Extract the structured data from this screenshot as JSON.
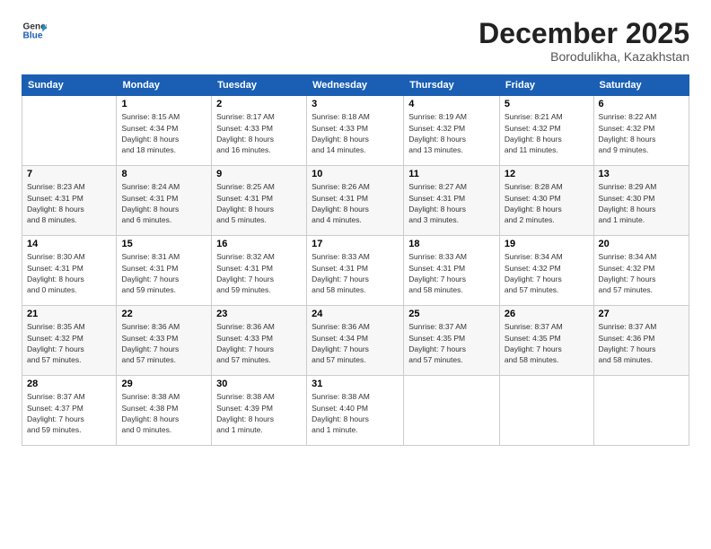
{
  "header": {
    "logo_line1": "General",
    "logo_line2": "Blue",
    "month": "December 2025",
    "location": "Borodulikha, Kazakhstan"
  },
  "days_of_week": [
    "Sunday",
    "Monday",
    "Tuesday",
    "Wednesday",
    "Thursday",
    "Friday",
    "Saturday"
  ],
  "weeks": [
    [
      {
        "day": "",
        "info": ""
      },
      {
        "day": "1",
        "info": "Sunrise: 8:15 AM\nSunset: 4:34 PM\nDaylight: 8 hours\nand 18 minutes."
      },
      {
        "day": "2",
        "info": "Sunrise: 8:17 AM\nSunset: 4:33 PM\nDaylight: 8 hours\nand 16 minutes."
      },
      {
        "day": "3",
        "info": "Sunrise: 8:18 AM\nSunset: 4:33 PM\nDaylight: 8 hours\nand 14 minutes."
      },
      {
        "day": "4",
        "info": "Sunrise: 8:19 AM\nSunset: 4:32 PM\nDaylight: 8 hours\nand 13 minutes."
      },
      {
        "day": "5",
        "info": "Sunrise: 8:21 AM\nSunset: 4:32 PM\nDaylight: 8 hours\nand 11 minutes."
      },
      {
        "day": "6",
        "info": "Sunrise: 8:22 AM\nSunset: 4:32 PM\nDaylight: 8 hours\nand 9 minutes."
      }
    ],
    [
      {
        "day": "7",
        "info": "Sunrise: 8:23 AM\nSunset: 4:31 PM\nDaylight: 8 hours\nand 8 minutes."
      },
      {
        "day": "8",
        "info": "Sunrise: 8:24 AM\nSunset: 4:31 PM\nDaylight: 8 hours\nand 6 minutes."
      },
      {
        "day": "9",
        "info": "Sunrise: 8:25 AM\nSunset: 4:31 PM\nDaylight: 8 hours\nand 5 minutes."
      },
      {
        "day": "10",
        "info": "Sunrise: 8:26 AM\nSunset: 4:31 PM\nDaylight: 8 hours\nand 4 minutes."
      },
      {
        "day": "11",
        "info": "Sunrise: 8:27 AM\nSunset: 4:31 PM\nDaylight: 8 hours\nand 3 minutes."
      },
      {
        "day": "12",
        "info": "Sunrise: 8:28 AM\nSunset: 4:30 PM\nDaylight: 8 hours\nand 2 minutes."
      },
      {
        "day": "13",
        "info": "Sunrise: 8:29 AM\nSunset: 4:30 PM\nDaylight: 8 hours\nand 1 minute."
      }
    ],
    [
      {
        "day": "14",
        "info": "Sunrise: 8:30 AM\nSunset: 4:31 PM\nDaylight: 8 hours\nand 0 minutes."
      },
      {
        "day": "15",
        "info": "Sunrise: 8:31 AM\nSunset: 4:31 PM\nDaylight: 7 hours\nand 59 minutes."
      },
      {
        "day": "16",
        "info": "Sunrise: 8:32 AM\nSunset: 4:31 PM\nDaylight: 7 hours\nand 59 minutes."
      },
      {
        "day": "17",
        "info": "Sunrise: 8:33 AM\nSunset: 4:31 PM\nDaylight: 7 hours\nand 58 minutes."
      },
      {
        "day": "18",
        "info": "Sunrise: 8:33 AM\nSunset: 4:31 PM\nDaylight: 7 hours\nand 58 minutes."
      },
      {
        "day": "19",
        "info": "Sunrise: 8:34 AM\nSunset: 4:32 PM\nDaylight: 7 hours\nand 57 minutes."
      },
      {
        "day": "20",
        "info": "Sunrise: 8:34 AM\nSunset: 4:32 PM\nDaylight: 7 hours\nand 57 minutes."
      }
    ],
    [
      {
        "day": "21",
        "info": "Sunrise: 8:35 AM\nSunset: 4:32 PM\nDaylight: 7 hours\nand 57 minutes."
      },
      {
        "day": "22",
        "info": "Sunrise: 8:36 AM\nSunset: 4:33 PM\nDaylight: 7 hours\nand 57 minutes."
      },
      {
        "day": "23",
        "info": "Sunrise: 8:36 AM\nSunset: 4:33 PM\nDaylight: 7 hours\nand 57 minutes."
      },
      {
        "day": "24",
        "info": "Sunrise: 8:36 AM\nSunset: 4:34 PM\nDaylight: 7 hours\nand 57 minutes."
      },
      {
        "day": "25",
        "info": "Sunrise: 8:37 AM\nSunset: 4:35 PM\nDaylight: 7 hours\nand 57 minutes."
      },
      {
        "day": "26",
        "info": "Sunrise: 8:37 AM\nSunset: 4:35 PM\nDaylight: 7 hours\nand 58 minutes."
      },
      {
        "day": "27",
        "info": "Sunrise: 8:37 AM\nSunset: 4:36 PM\nDaylight: 7 hours\nand 58 minutes."
      }
    ],
    [
      {
        "day": "28",
        "info": "Sunrise: 8:37 AM\nSunset: 4:37 PM\nDaylight: 7 hours\nand 59 minutes."
      },
      {
        "day": "29",
        "info": "Sunrise: 8:38 AM\nSunset: 4:38 PM\nDaylight: 8 hours\nand 0 minutes."
      },
      {
        "day": "30",
        "info": "Sunrise: 8:38 AM\nSunset: 4:39 PM\nDaylight: 8 hours\nand 1 minute."
      },
      {
        "day": "31",
        "info": "Sunrise: 8:38 AM\nSunset: 4:40 PM\nDaylight: 8 hours\nand 1 minute."
      },
      {
        "day": "",
        "info": ""
      },
      {
        "day": "",
        "info": ""
      },
      {
        "day": "",
        "info": ""
      }
    ]
  ]
}
